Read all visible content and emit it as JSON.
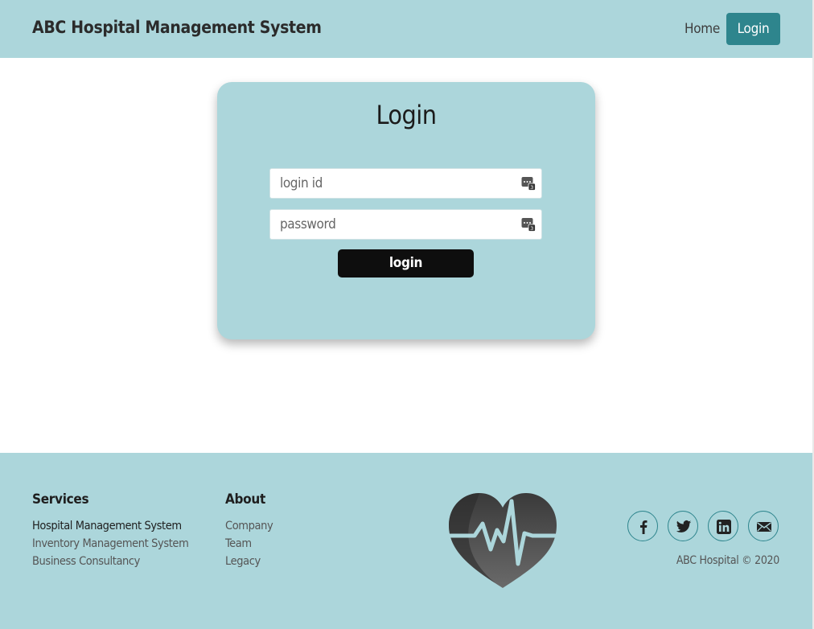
{
  "header": {
    "brand": "ABC Hospital Management System",
    "nav": {
      "home": "Home",
      "login": "Login"
    }
  },
  "login_card": {
    "title": "Login",
    "login_id_placeholder": "login id",
    "password_placeholder": "password",
    "submit_label": "login"
  },
  "footer": {
    "services": {
      "heading": "Services",
      "links": [
        "Hospital Management System",
        "Inventory Management System",
        "Business Consultancy"
      ]
    },
    "about": {
      "heading": "About",
      "links": [
        "Company",
        "Team",
        "Legacy"
      ]
    },
    "social_icons": [
      "facebook-icon",
      "twitter-icon",
      "linkedin-icon",
      "mail-icon"
    ],
    "copyright": "ABC Hospital © 2020"
  },
  "colors": {
    "header_bg": "#acd6db",
    "accent": "#2e858d",
    "button_dark": "#0e0e0e"
  }
}
